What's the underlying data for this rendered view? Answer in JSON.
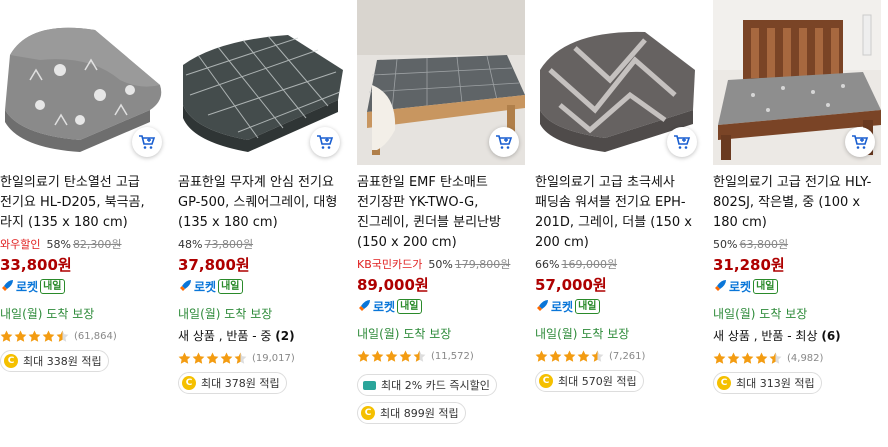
{
  "products": [
    {
      "title": "한일의료기 탄소열선 고급 전기요 HL-D205, 북극곰, 라지 (135 x 180 cm)",
      "coupon": "와우할인",
      "rate": "58%",
      "original_price": "82,300원",
      "price": "33,800원",
      "rocket_label": "로켓",
      "rocket_badge": "내일",
      "delivery": "내일(월) 도착 보장",
      "extra": "",
      "rating": 4.5,
      "review_count": "(61,864)",
      "reward": "최대 338원 적립",
      "card_discount": ""
    },
    {
      "title": "곰표한일 무자계 안심 전기요 GP-500, 스퀘어그레이, 대형 (135 x 180 cm)",
      "coupon": "",
      "rate": "48%",
      "original_price": "73,800원",
      "price": "37,800원",
      "rocket_label": "로켓",
      "rocket_badge": "내일",
      "delivery": "내일(월) 도착 보장",
      "extra": "새 상품 , 반품 - 중",
      "extra_count": "(2)",
      "rating": 4.5,
      "review_count": "(19,017)",
      "reward": "최대 378원 적립",
      "card_discount": ""
    },
    {
      "title": "곰표한일 EMF 탄소매트 전기장판 YK-TWO-G, 진그레이, 퀸더블 분리난방(150 x 200 cm)",
      "coupon": "KB국민카드가",
      "rate": "50%",
      "original_price": "179,800원",
      "price": "89,000원",
      "rocket_label": "로켓",
      "rocket_badge": "내일",
      "delivery": "내일(월) 도착 보장",
      "extra": "",
      "rating": 4.5,
      "review_count": "(11,572)",
      "reward": "최대 899원 적립",
      "card_discount": "최대 2% 카드 즉시할인"
    },
    {
      "title": "한일의료기 고급 초극세사 패딩솜 워셔블 전기요 EPH-201D, 그레이, 더블 (150 x 200 cm)",
      "coupon": "",
      "rate": "66%",
      "original_price": "169,000원",
      "price": "57,000원",
      "rocket_label": "로켓",
      "rocket_badge": "내일",
      "delivery": "내일(월) 도착 보장",
      "extra": "",
      "rating": 4.5,
      "review_count": "(7,261)",
      "reward": "최대 570원 적립",
      "card_discount": ""
    },
    {
      "title": "한일의료기 고급 전기요 HLY-802SJ, 작은별, 중 (100 x 180 cm)",
      "coupon": "",
      "rate": "50%",
      "original_price": "63,800원",
      "price": "31,280원",
      "rocket_label": "로켓",
      "rocket_badge": "내일",
      "delivery": "내일(월) 도착 보장",
      "extra": "새 상품 , 반품 - 최상",
      "extra_count": "(6)",
      "rating": 4.5,
      "review_count": "(4,982)",
      "reward": "최대 313원 적립",
      "card_discount": ""
    }
  ],
  "colors": {
    "price": "#ae0000",
    "coupon": "#e02020",
    "delivery": "#2e8b3a",
    "rocket": "#0a76d8",
    "star": "#f39c12"
  }
}
